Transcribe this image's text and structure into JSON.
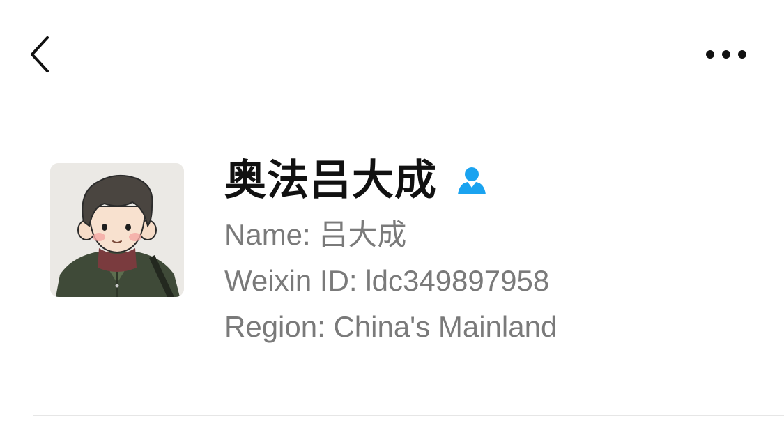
{
  "header": {
    "back_icon": "chevron-left-icon",
    "more_icon": "more-horizontal-icon"
  },
  "profile": {
    "avatar_icon": "cartoon-avatar",
    "nickname": "奥法吕大成",
    "contact_icon": "person-badge-icon",
    "contact_icon_color": "#1aa3f0",
    "name_label": "Name:",
    "name_value": "吕大成",
    "id_label": "Weixin ID:",
    "id_value": "ldc349897958",
    "region_label": "Region:",
    "region_value": "China's Mainland"
  },
  "colors": {
    "text_primary": "#111111",
    "text_secondary": "#7a7a7a",
    "accent": "#1aa3f0",
    "divider": "#e6e6e6"
  }
}
